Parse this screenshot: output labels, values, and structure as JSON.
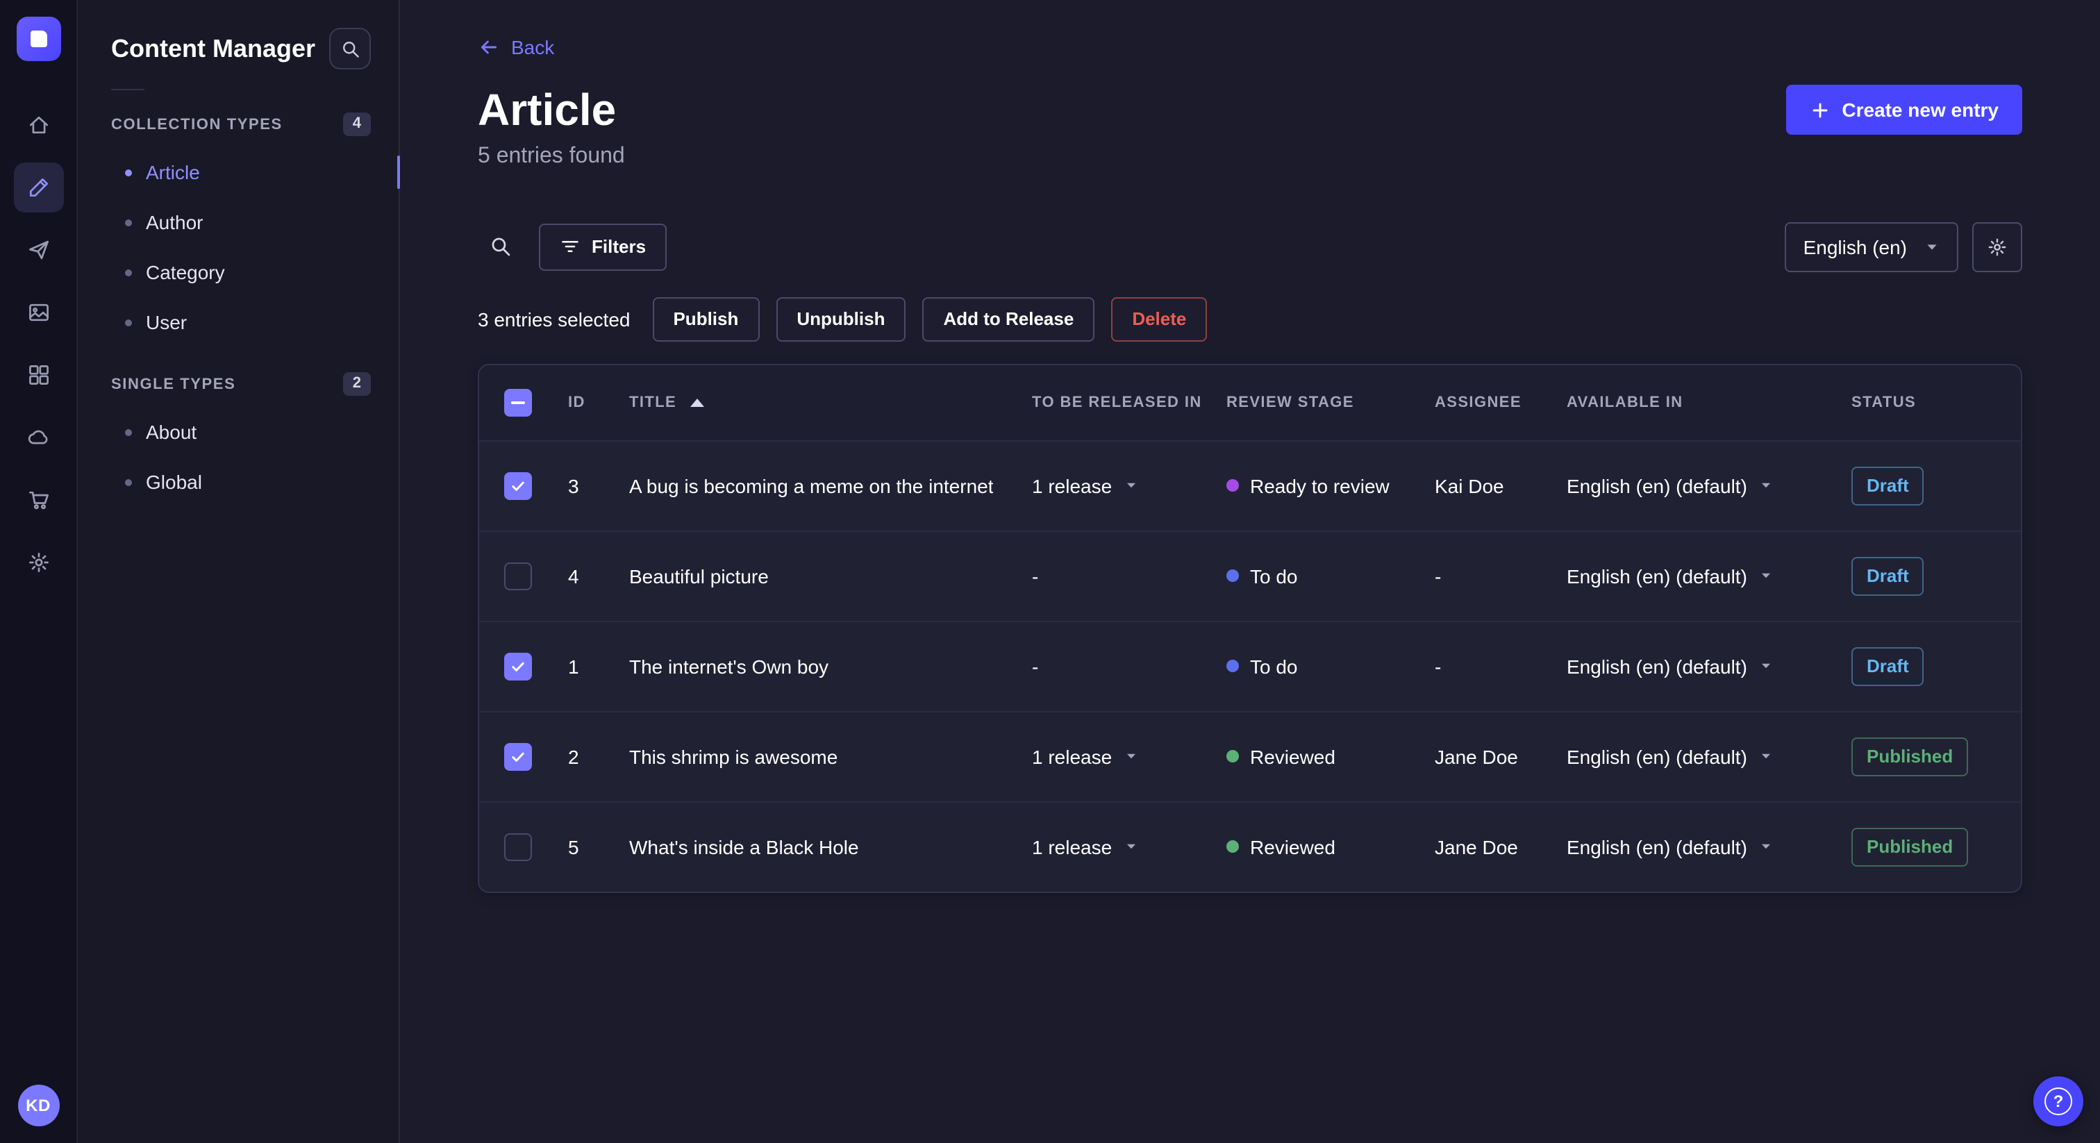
{
  "app": {
    "avatar_initials": "KD"
  },
  "nav_rail": {
    "icons": [
      "home",
      "content-manager",
      "releases",
      "media-library",
      "content-type-builder",
      "deploy-cloud",
      "marketplace",
      "settings"
    ]
  },
  "sidebar": {
    "title": "Content Manager",
    "sections": [
      {
        "label": "COLLECTION TYPES",
        "badge": "4",
        "items": [
          {
            "label": "Article",
            "active": true
          },
          {
            "label": "Author",
            "active": false
          },
          {
            "label": "Category",
            "active": false
          },
          {
            "label": "User",
            "active": false
          }
        ]
      },
      {
        "label": "SINGLE TYPES",
        "badge": "2",
        "items": [
          {
            "label": "About",
            "active": false
          },
          {
            "label": "Global",
            "active": false
          }
        ]
      }
    ]
  },
  "header": {
    "back_label": "Back",
    "title": "Article",
    "subtitle": "5 entries found",
    "create_button": "Create new entry"
  },
  "toolbar": {
    "filters_label": "Filters",
    "locale_value": "English (en)"
  },
  "selection": {
    "count_text": "3 entries selected",
    "publish": "Publish",
    "unpublish": "Unpublish",
    "add_to_release": "Add to Release",
    "delete": "Delete"
  },
  "table": {
    "headers": {
      "id": "ID",
      "title": "TITLE",
      "release": "TO BE RELEASED IN",
      "stage": "REVIEW STAGE",
      "assignee": "ASSIGNEE",
      "available": "AVAILABLE IN",
      "status": "STATUS"
    },
    "rows": [
      {
        "checked": true,
        "id": "3",
        "title": "A bug is becoming a meme on the internet",
        "release": "1 release",
        "stage": "Ready to review",
        "assignee": "Kai Doe",
        "locale": "English (en) (default)",
        "status": "Draft"
      },
      {
        "checked": false,
        "id": "4",
        "title": "Beautiful picture",
        "release": "-",
        "stage": "To do",
        "assignee": "-",
        "locale": "English (en) (default)",
        "status": "Draft"
      },
      {
        "checked": true,
        "id": "1",
        "title": "The internet's Own boy",
        "release": "-",
        "stage": "To do",
        "assignee": "-",
        "locale": "English (en) (default)",
        "status": "Draft"
      },
      {
        "checked": true,
        "id": "2",
        "title": "This shrimp is awesome",
        "release": "1 release",
        "stage": "Reviewed",
        "assignee": "Jane Doe",
        "locale": "English (en) (default)",
        "status": "Published"
      },
      {
        "checked": false,
        "id": "5",
        "title": "What's inside a Black Hole",
        "release": "1 release",
        "stage": "Reviewed",
        "assignee": "Jane Doe",
        "locale": "English (en) (default)",
        "status": "Published"
      }
    ]
  },
  "help_button": {
    "label": "?"
  },
  "colors": {
    "accent": "#4945ff",
    "accent_light": "#7b79ff",
    "success": "#5cb176",
    "danger": "#ee5e52",
    "draft_status": "#66b7f1",
    "published_status": "#5cb176",
    "stage_ready_to_review": "#a54ce8",
    "stage_to_do": "#5c6fef",
    "stage_reviewed": "#5cb176"
  }
}
